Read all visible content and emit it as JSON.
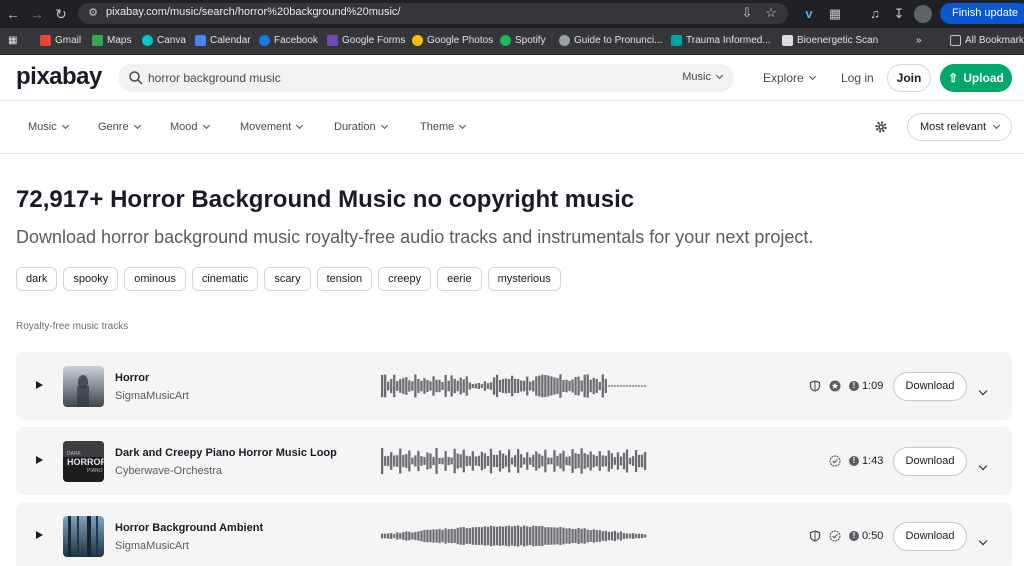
{
  "browser": {
    "url": "pixabay.com/music/search/horror%20background%20music/",
    "finish_update": "Finish update",
    "bookmarks": [
      {
        "label": "Gmail",
        "color": "#ea4335"
      },
      {
        "label": "Maps",
        "color": "#34a853"
      },
      {
        "label": "Canva",
        "color": "#00c4cc"
      },
      {
        "label": "Calendar",
        "color": "#4285f4"
      },
      {
        "label": "Facebook",
        "color": "#1877f2"
      },
      {
        "label": "Google Forms",
        "color": "#7248b9"
      },
      {
        "label": "Google Photos",
        "color": "#fbbc04"
      },
      {
        "label": "Spotify",
        "color": "#1db954"
      },
      {
        "label": "Guide to Pronunci...",
        "color": "#9aa0a6"
      },
      {
        "label": "Trauma Informed...",
        "color": "#00a3a3"
      },
      {
        "label": "Bioenergetic Scan",
        "color": "#dadce0"
      }
    ],
    "all_bookmarks": "All Bookmarks"
  },
  "header": {
    "logo": "pixabay",
    "search_value": "horror background music",
    "search_scope": "Music",
    "explore": "Explore",
    "login": "Log in",
    "join": "Join",
    "upload": "Upload"
  },
  "filters": [
    "Music",
    "Genre",
    "Mood",
    "Movement",
    "Duration",
    "Theme"
  ],
  "sort": "Most relevant",
  "page": {
    "title": "72,917+ Horror Background Music no copyright music",
    "subtitle": "Download horror background music royalty-free audio tracks and instrumentals for your next project.",
    "tags": [
      "dark",
      "spooky",
      "ominous",
      "cinematic",
      "scary",
      "tension",
      "creepy",
      "eerie",
      "mysterious"
    ],
    "section_label": "Royalty-free music tracks"
  },
  "tracks": [
    {
      "title": "Horror",
      "artist": "SigmaMusicArt",
      "duration": "1:09",
      "download": "Download",
      "icons": [
        "shield-icon",
        "star-badge-icon"
      ]
    },
    {
      "title": "Dark and Creepy Piano Horror Music Loop",
      "artist": "Cyberwave-Orchestra",
      "duration": "1:43",
      "download": "Download",
      "icons": [
        "check-badge-icon"
      ]
    },
    {
      "title": "Horror Background Ambient",
      "artist": "SigmaMusicArt",
      "duration": "0:50",
      "download": "Download",
      "icons": [
        "shield-icon",
        "check-badge-icon"
      ]
    }
  ],
  "thumbnail_text": {
    "horror_word": "HORROR",
    "piano_word": "PIANO",
    "dark_word": "DARK"
  },
  "colors": {
    "accent": "#00a96b",
    "browser_blue": "#0b57d0"
  }
}
